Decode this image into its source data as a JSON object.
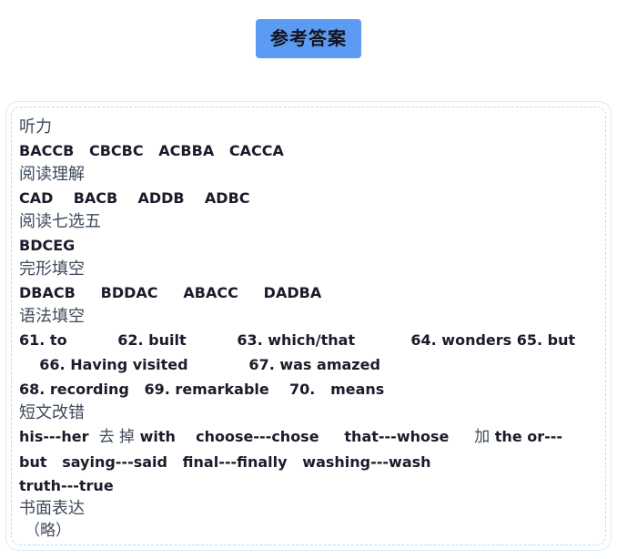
{
  "title": {
    "badge_label": "参考答案",
    "badge_bg": "#5b9bf3",
    "badge_text_color": "#15151f"
  },
  "card": {
    "border_color": "#dbeafe",
    "dashed_border_color": "#bfdcf7",
    "background": "#ffffff"
  },
  "sections": {
    "listening": {
      "heading": "听力",
      "answers": "BACCB   CBCBC   ACBBA   CACCA"
    },
    "reading": {
      "heading": "阅读理解",
      "answers": "CAD    BACB    ADDB    ADBC"
    },
    "seven_choose_five": {
      "heading": "阅读七选五",
      "answers": "BDCEG"
    },
    "cloze": {
      "heading": "完形填空",
      "answers": "DBACB     BDDAC     ABACC     DADBA"
    },
    "grammar_fill": {
      "heading": "语法填空",
      "line1": "61. to          62. built          63. which/that           64. wonders 65. but",
      "line2": "    66. Having visited            67. was amazed",
      "line3": "68. recording   69. remarkable    70.   means"
    },
    "error_correction": {
      "heading": "短文改错",
      "line1_part1": "his---her  ",
      "line1_cn1": "去 掉",
      "line1_part2": " with    choose---chose     that---whose     ",
      "line1_cn2": "加",
      "line1_part3": " the or---",
      "line2": "but   saying---said   final---finally   washing---wash",
      "line3": "truth---true"
    },
    "writing": {
      "heading": "书面表达",
      "content": "（略）"
    }
  }
}
